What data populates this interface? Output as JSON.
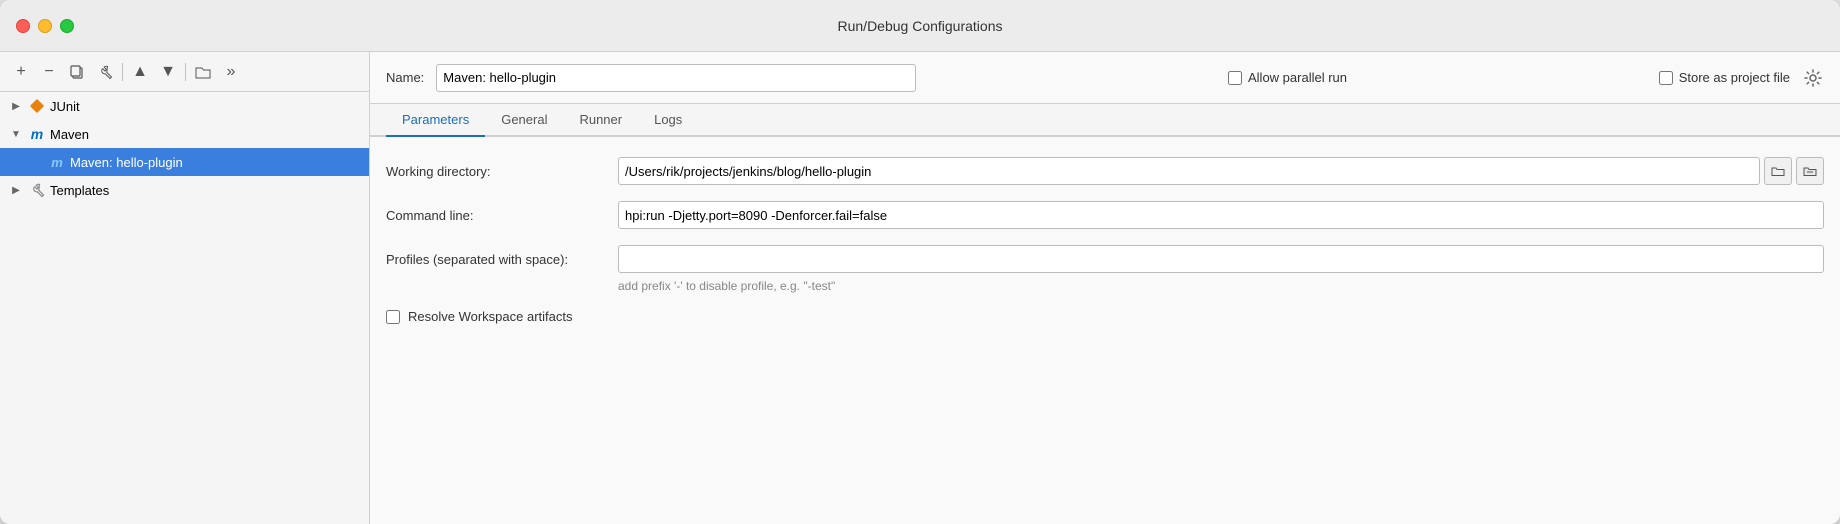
{
  "window": {
    "title": "Run/Debug Configurations"
  },
  "toolbar": {
    "add_label": "+",
    "remove_label": "−",
    "copy_label": "⧉",
    "settings_label": "⚙",
    "up_label": "▲",
    "down_label": "▼",
    "folder_label": "📁",
    "more_label": "»"
  },
  "tree": {
    "items": [
      {
        "id": "junit",
        "label": "JUnit",
        "level": 1,
        "expanded": false,
        "type": "junit"
      },
      {
        "id": "maven",
        "label": "Maven",
        "level": 1,
        "expanded": true,
        "type": "maven"
      },
      {
        "id": "maven-hello-plugin",
        "label": "Maven: hello-plugin",
        "level": 2,
        "selected": true,
        "type": "maven-child"
      },
      {
        "id": "templates",
        "label": "Templates",
        "level": 1,
        "expanded": false,
        "type": "templates"
      }
    ]
  },
  "right": {
    "name_label": "Name:",
    "name_value": "Maven: hello-plugin",
    "allow_parallel_label": "Allow parallel run",
    "store_project_label": "Store as project file",
    "tabs": [
      {
        "id": "parameters",
        "label": "Parameters",
        "active": true
      },
      {
        "id": "general",
        "label": "General",
        "active": false
      },
      {
        "id": "runner",
        "label": "Runner",
        "active": false
      },
      {
        "id": "logs",
        "label": "Logs",
        "active": false
      }
    ],
    "parameters": {
      "working_directory_label": "Working directory:",
      "working_directory_value": "/Users/rik/projects/jenkins/blog/hello-plugin",
      "command_line_label": "Command line:",
      "command_line_value": "hpi:run -Djetty.port=8090 -Denforcer.fail=false",
      "profiles_label": "Profiles (separated with space):",
      "profiles_value": "",
      "profiles_hint": "add prefix '-' to disable profile, e.g. \"-test\"",
      "resolve_label": "Resolve Workspace artifacts"
    }
  }
}
